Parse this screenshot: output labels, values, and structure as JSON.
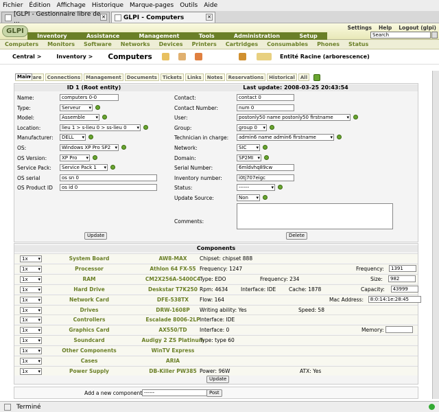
{
  "browser": {
    "menu": [
      "Fichier",
      "Édition",
      "Affichage",
      "Historique",
      "Marque-pages",
      "Outils",
      "Aide"
    ],
    "tabs": [
      "[GLPI - Gestionnaire libre de ...",
      "GLPI - Computers"
    ],
    "status": "Terminé"
  },
  "header": {
    "logo": "GLPI",
    "main_menu": [
      "Inventory",
      "Assistance",
      "Management",
      "Tools",
      "Administration",
      "Setup"
    ],
    "top_links": [
      "Settings",
      "Help",
      "Logout (glpi)"
    ],
    "search_placeholder": "Search"
  },
  "submenu": [
    "Computers",
    "Monitors",
    "Software",
    "Networks",
    "Devices",
    "Printers",
    "Cartridges",
    "Consumables",
    "Phones",
    "Status"
  ],
  "breadcrumb": {
    "central": "Central >",
    "inventory": "Inventory >",
    "current": "Computers",
    "entity": "Entité Racine (arborescence)"
  },
  "form_tabs": [
    "Main",
    "Software",
    "Connections",
    "Management",
    "Documents",
    "Tickets",
    "Links",
    "Notes",
    "Reservations",
    "Historical",
    "All"
  ],
  "form": {
    "id_title": "ID 1 (Root entity)",
    "last_update": "Last update: 2008-03-25 20:43:54",
    "left": [
      {
        "label": "Name:",
        "value": "computers 0-0",
        "kind": "input"
      },
      {
        "label": "Type:",
        "value": "Serveur",
        "kind": "select"
      },
      {
        "label": "Model:",
        "value": "Assemble",
        "kind": "select"
      },
      {
        "label": "Location:",
        "value": "lieu 1 > s-lieu 0 > ss-lieu 0",
        "kind": "select"
      },
      {
        "label": "Manufacturer:",
        "value": "DELL",
        "kind": "select"
      },
      {
        "label": "OS:",
        "value": "Windows XP Pro SP2",
        "kind": "select"
      },
      {
        "label": "OS Version:",
        "value": "XP Pro",
        "kind": "select"
      },
      {
        "label": "Service Pack:",
        "value": "Service Pack 1",
        "kind": "select"
      },
      {
        "label": "OS serial",
        "value": "os sn 0",
        "kind": "input"
      },
      {
        "label": "OS Product ID",
        "value": "os id 0",
        "kind": "input"
      }
    ],
    "right": [
      {
        "label": "Contact:",
        "value": "contact 0",
        "kind": "input"
      },
      {
        "label": "Contact Number:",
        "value": "num 0",
        "kind": "input"
      },
      {
        "label": "User:",
        "value": "postonly50 name postonly50 firstname",
        "kind": "select"
      },
      {
        "label": "Group:",
        "value": "group 0",
        "kind": "select"
      },
      {
        "label": "Technician in charge:",
        "value": "admin6 name admin6 firstname",
        "kind": "select"
      },
      {
        "label": "Network:",
        "value": "SIC",
        "kind": "select"
      },
      {
        "label": "Domain:",
        "value": "SP2MI",
        "kind": "select"
      },
      {
        "label": "Serial Number:",
        "value": "6mldvhq89cw",
        "kind": "input"
      },
      {
        "label": "Inventory number:",
        "value": "i0tj707eigc",
        "kind": "input"
      },
      {
        "label": "Status:",
        "value": "------",
        "kind": "select"
      },
      {
        "label": "Update Source:",
        "value": "Non",
        "kind": "select"
      }
    ],
    "comments_label": "Comments:",
    "update_button": "Update",
    "delete_button": "Delete"
  },
  "components": {
    "title": "Components",
    "rows": [
      {
        "qty": "1x",
        "name": "System Board",
        "model": "AW8-MAX",
        "specs": [
          {
            "t": "Chipset: chipset 888"
          }
        ]
      },
      {
        "qty": "1x",
        "name": "Processor",
        "model": "Athlon 64 FX-55",
        "specs": [
          {
            "t": "Frequency: 1247"
          },
          {
            "t": "Frequency:",
            "v": "1391"
          }
        ]
      },
      {
        "qty": "1x",
        "name": "RAM",
        "model": "CM2X256A-5400C4",
        "specs": [
          {
            "t": "Type: EDO"
          },
          {
            "t": "Frequency: 234"
          },
          {
            "t": "Size:",
            "v": "982"
          }
        ]
      },
      {
        "qty": "1x",
        "name": "Hard Drive",
        "model": "Deskstar T7K250",
        "specs": [
          {
            "t": "Rpm: 4634"
          },
          {
            "t": "Interface: IDE"
          },
          {
            "t": "Cache: 1878"
          },
          {
            "t": "Capacity:",
            "v": "43999"
          }
        ]
      },
      {
        "qty": "1x",
        "name": "Network Card",
        "model": "DFE-538TX",
        "specs": [
          {
            "t": "Flow: 164"
          },
          {
            "t": "Mac Address:",
            "v": "8:0:14:1e:28:45"
          }
        ]
      },
      {
        "qty": "1x",
        "name": "Drives",
        "model": "DRW-1608P",
        "specs": [
          {
            "t": "Writing ability: Yes"
          },
          {
            "t": "Speed: 58"
          }
        ]
      },
      {
        "qty": "1x",
        "name": "Controllers",
        "model": "Escalade 8006-2LP",
        "specs": [
          {
            "t": "Interface: IDE"
          }
        ]
      },
      {
        "qty": "1x",
        "name": "Graphics Card",
        "model": "AX550/TD",
        "specs": [
          {
            "t": "Interface: 0"
          },
          {
            "t": "Memory:",
            "v": ""
          }
        ]
      },
      {
        "qty": "1x",
        "name": "Soundcard",
        "model": "Audigy 2 ZS Platinum",
        "specs": [
          {
            "t": "Type: type 60"
          }
        ]
      },
      {
        "qty": "1x",
        "name": "Other Components",
        "model": "WinTV Express",
        "specs": []
      },
      {
        "qty": "1x",
        "name": "Cases",
        "model": "ARIA",
        "specs": []
      },
      {
        "qty": "1x",
        "name": "Power Supply",
        "model": "DB-Killer PW385",
        "specs": [
          {
            "t": "Power: 96W"
          },
          {
            "t": "ATX: Yes"
          }
        ]
      }
    ],
    "update_button": "Update",
    "add_label": "Add a new component:",
    "add_value": "------",
    "post_button": "Post"
  }
}
